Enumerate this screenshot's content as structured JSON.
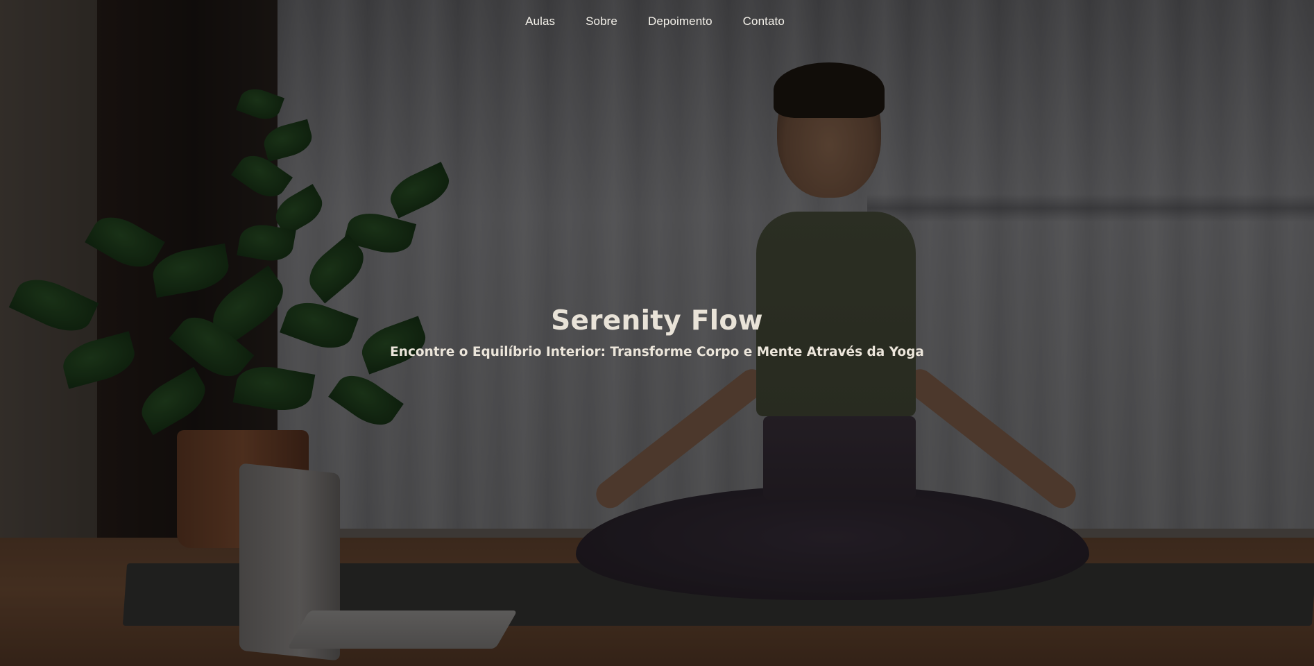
{
  "nav": {
    "items": [
      {
        "label": "Aulas"
      },
      {
        "label": "Sobre"
      },
      {
        "label": "Depoimento"
      },
      {
        "label": "Contato"
      }
    ]
  },
  "hero": {
    "title": "Serenity Flow",
    "subtitle": "Encontre o Equilíbrio Interior: Transforme Corpo e Mente Através da Yoga",
    "background": "yoga-meditation-photo"
  },
  "colors": {
    "text": "#e9e3d8",
    "overlay": "rgba(0,0,0,0.45)"
  }
}
